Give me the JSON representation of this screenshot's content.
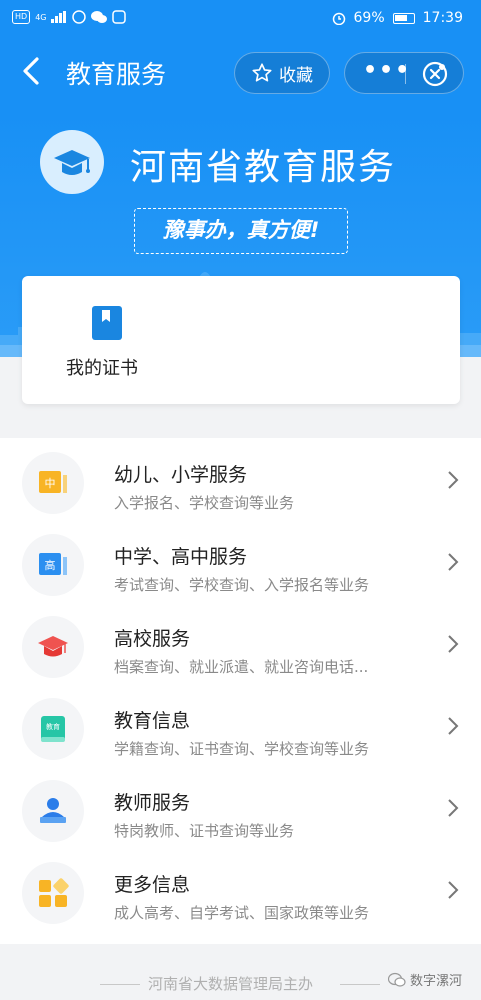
{
  "statusbar": {
    "network": "HD",
    "signal_label": "4G",
    "battery": "69%",
    "time": "17:39"
  },
  "navbar": {
    "title": "教育服务",
    "favorite_label": "收藏",
    "more_label": "•••"
  },
  "banner": {
    "title": "河南省教育服务",
    "slogan": "豫事办，真方便!"
  },
  "certificate": {
    "label": "我的证书"
  },
  "services": [
    {
      "title": "幼儿、小学服务",
      "subtitle": "入学报名、学校查询等业务",
      "icon": "primary-school-icon",
      "icon_text": "中"
    },
    {
      "title": "中学、高中服务",
      "subtitle": "考试查询、学校查询、入学报名等业务",
      "icon": "high-school-icon",
      "icon_text": "高"
    },
    {
      "title": "高校服务",
      "subtitle": "档案查询、就业派遣、就业咨询电话...",
      "icon": "graduation-cap-icon",
      "icon_text": ""
    },
    {
      "title": "教育信息",
      "subtitle": "学籍查询、证书查询、学校查询等业务",
      "icon": "education-book-icon",
      "icon_text": "教育"
    },
    {
      "title": "教师服务",
      "subtitle": "特岗教师、证书查询等业务",
      "icon": "teacher-icon",
      "icon_text": ""
    },
    {
      "title": "更多信息",
      "subtitle": "成人高考、自学考试、国家政策等业务",
      "icon": "more-grid-icon",
      "icon_text": ""
    }
  ],
  "footer": {
    "text": "河南省大数据管理局主办",
    "watermark": "数字漯河"
  },
  "colors": {
    "primary": "#1890f5",
    "banner_light": "#d9eefe"
  }
}
